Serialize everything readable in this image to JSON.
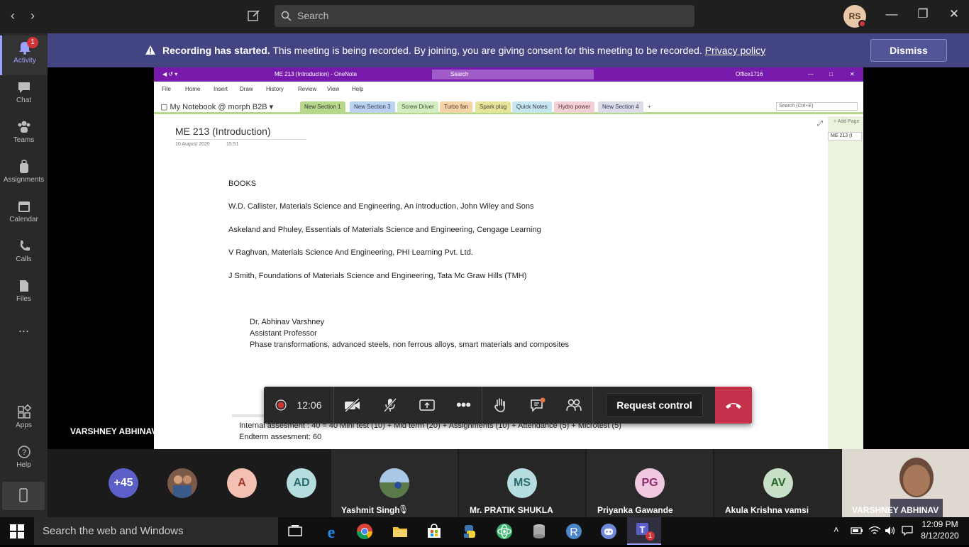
{
  "app": {
    "search_placeholder": "Search",
    "user_initials": "RS"
  },
  "rail": [
    {
      "label": "Activity",
      "icon": "bell-icon",
      "badge": "1"
    },
    {
      "label": "Chat",
      "icon": "chat-icon"
    },
    {
      "label": "Teams",
      "icon": "teams-icon"
    },
    {
      "label": "Assignments",
      "icon": "backpack-icon"
    },
    {
      "label": "Calendar",
      "icon": "calendar-icon"
    },
    {
      "label": "Calls",
      "icon": "phone-icon"
    },
    {
      "label": "Files",
      "icon": "files-icon"
    },
    {
      "label": "...",
      "icon": "more-icon"
    },
    {
      "label": "Apps",
      "icon": "apps-icon"
    },
    {
      "label": "Help",
      "icon": "help-icon"
    }
  ],
  "banner": {
    "bold": "Recording has started.",
    "text": "This meeting is being recorded. By joining, you are giving consent for this meeting to be recorded.",
    "link": "Privacy policy",
    "dismiss": "Dismiss"
  },
  "onenote": {
    "window_title": "ME 213 (Introduction) - OneNote",
    "search": "Search",
    "account": "Office1716",
    "menu": [
      "File",
      "Home",
      "Insert",
      "Draw",
      "History",
      "Review",
      "View",
      "Help"
    ],
    "notebook": "My Notebook @ morph B2B",
    "sections": [
      "New Section 1",
      "New Section 3",
      "Screw Driver",
      "Turbo fan",
      "Spark plug",
      "Quick Notes",
      "Hydro power",
      "New Section 4",
      "+"
    ],
    "search_box": "Search (Ctrl+E)",
    "add_page": "+ Add Page",
    "page_tab": "ME 213 (I",
    "page_title": "ME 213 (Introduction)",
    "page_date": "10 August 2020",
    "page_time": "15:51",
    "books_heading": "BOOKS",
    "books": [
      "W.D. Callister, Materials Science and Engineering, An introduction, John Wiley and Sons",
      "Askeland and Phuley, Essentials of Materials Science and Engineering, Cengage Learning",
      "V Raghvan, Materials Science And Engineering, PHI Learning Pvt. Ltd.",
      "J Smith, Foundations of Materials Science and Engineering, Tata Mc Graw Hills (TMH)"
    ],
    "instructor": {
      "name": "Dr. Abhinav Varshney",
      "title": "Assistant Professor",
      "research": "Phase transformations, advanced steels, non ferrous alloys, smart materials and composites"
    },
    "assessment_line": "Internal assesment : 40 = 40 Mini test (10) + Mid term (20) + Assignments (10) + Attendance (5) + Microtest (5)",
    "endterm_line": "Endterm assesment: 60"
  },
  "call": {
    "timer": "12:06",
    "request_control": "Request control",
    "presenter": "VARSHNEY ABHINAV"
  },
  "participants": {
    "overflow": "+45",
    "tiles": [
      {
        "initials": "",
        "name": "",
        "color": "#7b5a4a"
      },
      {
        "initials": "A",
        "name": "",
        "color": "#f3c0b3"
      },
      {
        "initials": "AD",
        "name": "",
        "color": "#b5dde0"
      },
      {
        "initials": "",
        "name": "Yashmit Singh",
        "color": "#6a8fa8"
      },
      {
        "initials": "MS",
        "name": "Mr. PRATIK SHUKLA",
        "color": "#b5dde0"
      },
      {
        "initials": "PG",
        "name": "Priyanka Gawande",
        "color": "#f0c8e0"
      },
      {
        "initials": "AV",
        "name": "Akula Krishna vamsi",
        "color": "#c8e0c8"
      },
      {
        "initials": "",
        "name": "VARSHNEY ABHINAV",
        "color": "#d8d0c8"
      }
    ]
  },
  "taskbar": {
    "search": "Search the web and Windows",
    "time": "12:09 PM",
    "date": "8/12/2020",
    "teams_badge": "1"
  }
}
